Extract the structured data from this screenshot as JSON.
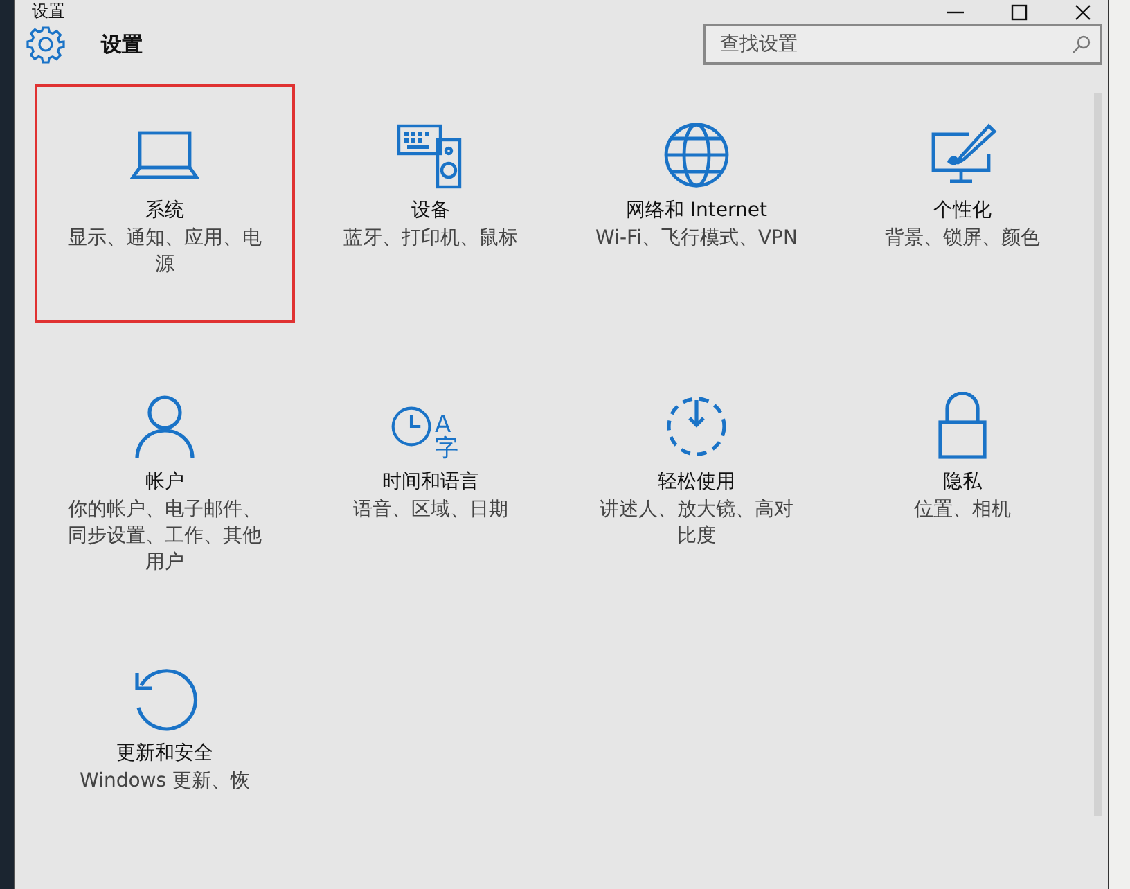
{
  "window": {
    "title": "设置"
  },
  "header": {
    "title": "设置",
    "search": {
      "placeholder": "查找设置"
    }
  },
  "tiles": [
    {
      "kind": "laptop",
      "title": "系统",
      "description": "显示、通知、应用、电源",
      "highlighted": true
    },
    {
      "kind": "devices",
      "title": "设备",
      "description": "蓝牙、打印机、鼠标",
      "highlighted": false
    },
    {
      "kind": "globe",
      "title": "网络和 Internet",
      "description": "Wi-Fi、飞行模式、VPN",
      "highlighted": false
    },
    {
      "kind": "paint",
      "title": "个性化",
      "description": "背景、锁屏、颜色",
      "highlighted": false
    },
    {
      "kind": "person",
      "title": "帐户",
      "description": "你的帐户、电子邮件、同步设置、工作、其他用户",
      "highlighted": false
    },
    {
      "kind": "clock",
      "icon_text": "A字",
      "title": "时间和语言",
      "description": "语音、区域、日期",
      "highlighted": false
    },
    {
      "kind": "access",
      "title": "轻松使用",
      "description": "讲述人、放大镜、高对比度",
      "highlighted": false
    },
    {
      "kind": "lock",
      "title": "隐私",
      "description": "位置、相机",
      "highlighted": false
    },
    {
      "kind": "refresh",
      "title": "更新和安全",
      "description": "Windows 更新、恢",
      "highlighted": false
    }
  ]
}
